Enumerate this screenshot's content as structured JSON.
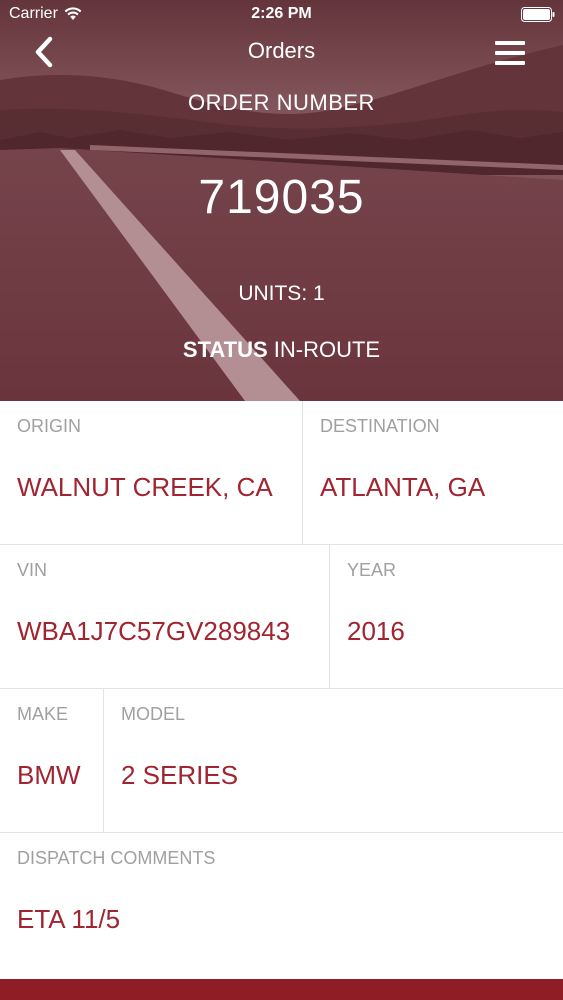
{
  "status_bar": {
    "carrier": "Carrier",
    "time": "2:26 PM",
    "wifi_icon": "wifi-icon",
    "battery_icon": "battery-icon"
  },
  "nav": {
    "title": "Orders",
    "back_icon": "chevron-left-icon",
    "menu_icon": "hamburger-menu-icon"
  },
  "order": {
    "number_label": "ORDER NUMBER",
    "number": "719035",
    "units": "UNITS: 1",
    "status_label": "STATUS",
    "status_value": "IN-ROUTE"
  },
  "details": {
    "origin": {
      "label": "ORIGIN",
      "value": "WALNUT CREEK, CA"
    },
    "destination": {
      "label": "DESTINATION",
      "value": "ATLANTA, GA"
    },
    "vin": {
      "label": "VIN",
      "value": "WBA1J7C57GV289843"
    },
    "year": {
      "label": "YEAR",
      "value": "2016"
    },
    "make": {
      "label": "MAKE",
      "value": "BMW"
    },
    "model": {
      "label": "MODEL",
      "value": "2 SERIES"
    },
    "dispatch_comments": {
      "label": "DISPATCH COMMENTS",
      "value": "ETA 11/5"
    }
  },
  "colors": {
    "accent": "#a02530",
    "label_gray": "#a0a0a0",
    "hero_tint": "#7a3a44",
    "footer": "#8e1d25"
  }
}
